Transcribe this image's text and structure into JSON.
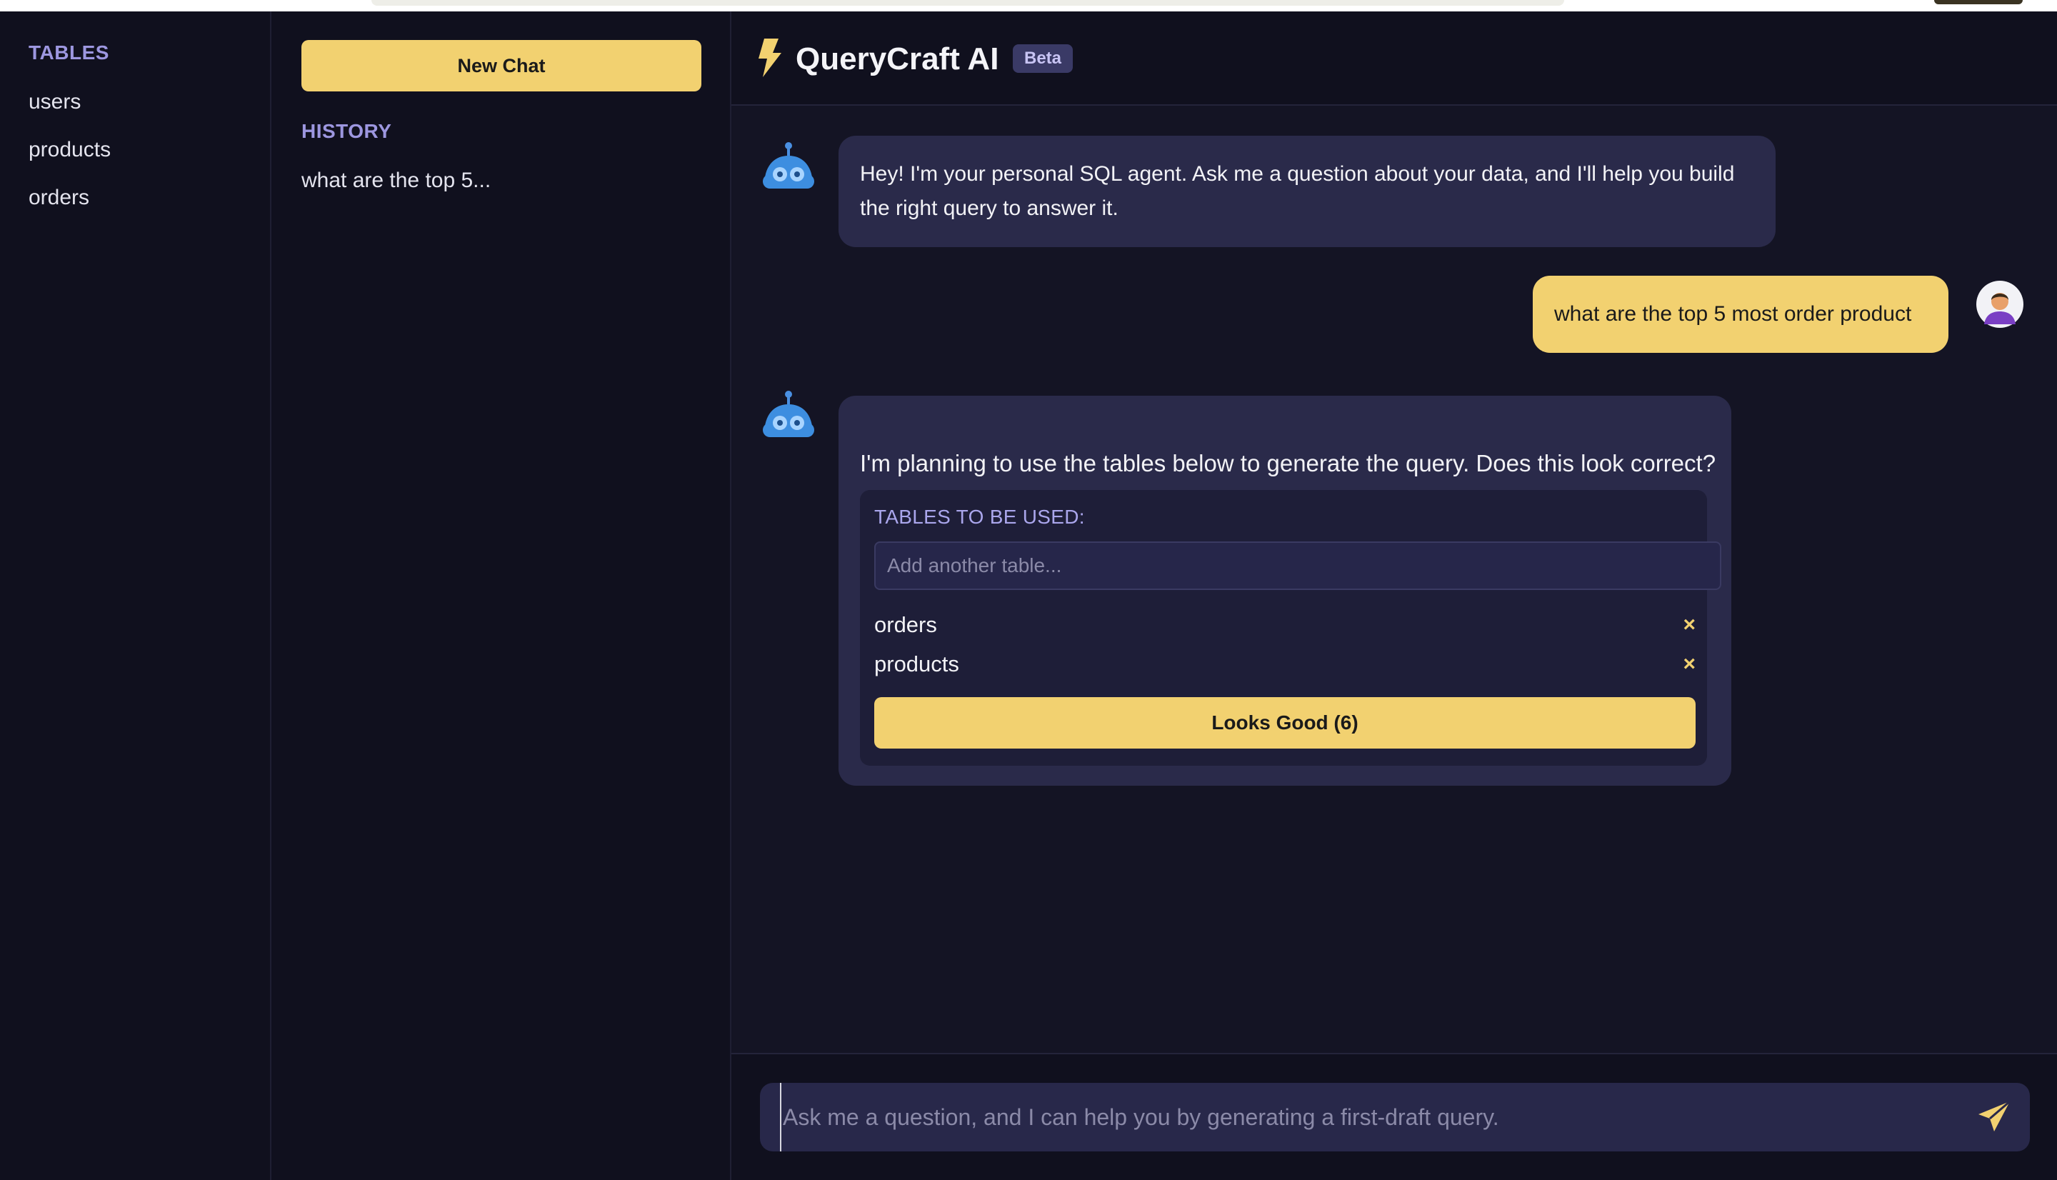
{
  "sidebar": {
    "tables_title": "TABLES",
    "tables": [
      "users",
      "products",
      "orders"
    ]
  },
  "history_panel": {
    "new_chat_label": "New Chat",
    "history_title": "HISTORY",
    "items": [
      "what are the top 5..."
    ]
  },
  "header": {
    "title": "QueryCraft AI",
    "badge": "Beta",
    "logo_icon": "lightning-bolt-icon"
  },
  "messages": [
    {
      "role": "bot",
      "text": "Hey! I'm your personal SQL agent. Ask me a question about your data, and I'll help you build the right query to answer it."
    },
    {
      "role": "user",
      "text": "what are the top 5 most order product"
    },
    {
      "role": "bot",
      "text": "I'm planning to use the tables below to generate the query. Does this look correct?",
      "panel": {
        "title": "TABLES TO BE USED:",
        "input_placeholder": "Add another table...",
        "selected_tables": [
          "orders",
          "products"
        ],
        "remove_glyph": "×",
        "confirm_label": "Looks Good (6)"
      }
    }
  ],
  "composer": {
    "placeholder": "Ask me a question, and I can help you by generating a first-draft query.",
    "value": "",
    "send_icon": "paper-plane-icon"
  },
  "colors": {
    "accent": "#f2d170",
    "section_title": "#9d97e0",
    "bot_bubble": "#2a2a4a",
    "background": "#10101e"
  }
}
